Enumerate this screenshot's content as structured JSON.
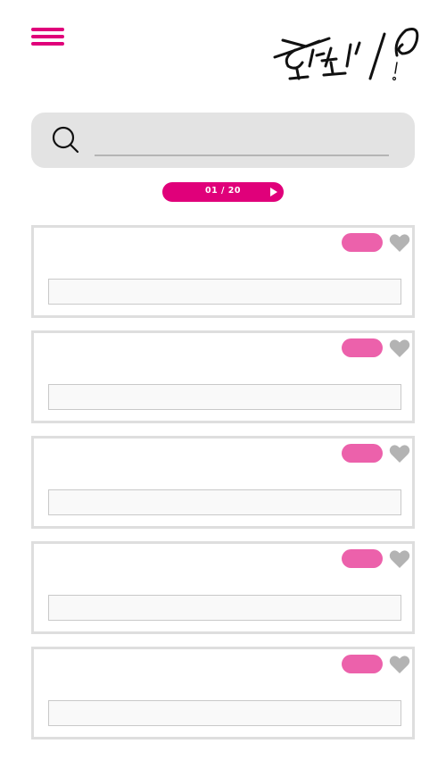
{
  "header": {
    "menu_icon": "hamburger-icon",
    "logo_text": "혼또니?"
  },
  "search": {
    "icon": "search-icon",
    "value": "",
    "placeholder": ""
  },
  "pager": {
    "label": "01 / 20",
    "current": 1,
    "total": 20,
    "next_icon": "play-icon"
  },
  "colors": {
    "accent": "#e0007a",
    "badge": "#ec61ab",
    "heart": "#b3b3b3",
    "search_bg": "#e3e3e3",
    "card_border": "#dedede"
  },
  "cards": [
    {
      "liked": false,
      "text": ""
    },
    {
      "liked": false,
      "text": ""
    },
    {
      "liked": false,
      "text": ""
    },
    {
      "liked": false,
      "text": ""
    },
    {
      "liked": false,
      "text": ""
    }
  ]
}
